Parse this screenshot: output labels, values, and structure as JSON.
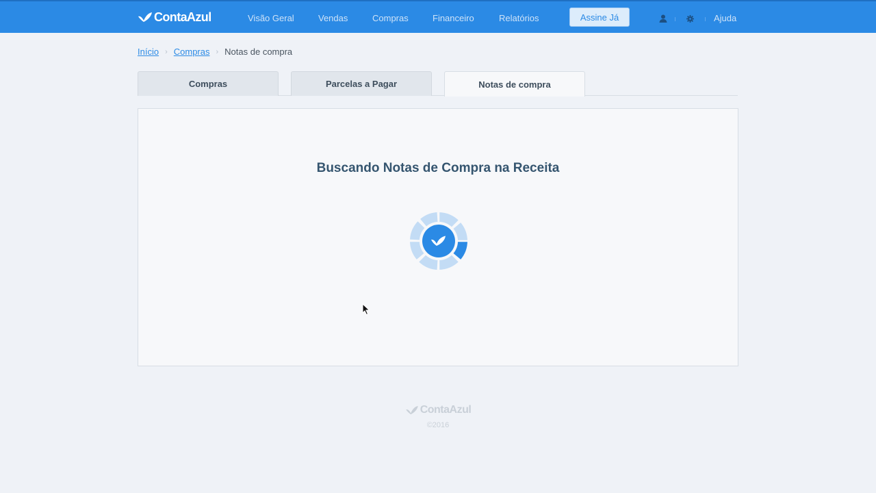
{
  "header": {
    "logo": "ContaAzul",
    "nav": [
      {
        "label": "Visão Geral"
      },
      {
        "label": "Vendas"
      },
      {
        "label": "Compras"
      },
      {
        "label": "Financeiro"
      },
      {
        "label": "Relatórios"
      }
    ],
    "subscribe_label": "Assine Já",
    "help_label": "Ajuda",
    "icons": [
      "user-icon",
      "gear-icon"
    ]
  },
  "breadcrumb": {
    "items": [
      {
        "label": "Início"
      },
      {
        "label": "Compras"
      },
      {
        "label": "Notas de compra"
      }
    ]
  },
  "tabs": [
    {
      "label": "Compras"
    },
    {
      "label": "Parcelas a Pagar"
    },
    {
      "label": "Notas de compra"
    }
  ],
  "main": {
    "title": "Buscando Notas de Compra na Receita"
  },
  "footer": {
    "logo": "ContaAzul",
    "year": "©2016"
  },
  "colors": {
    "brand_blue": "#2b8ae5",
    "background": "#eff2f7",
    "title_text": "#35556f"
  }
}
